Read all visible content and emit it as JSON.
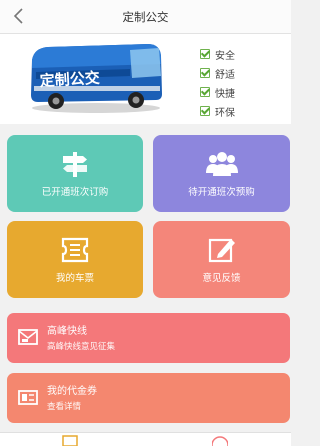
{
  "header": {
    "title": "定制公交"
  },
  "banner": {
    "bus_text": "定制公交",
    "features": [
      "安全",
      "舒适",
      "快捷",
      "环保"
    ]
  },
  "tiles": [
    {
      "label": "已开通班次订购",
      "color": "#5ec9b6",
      "icon": "signpost-icon"
    },
    {
      "label": "待开通班次预购",
      "color": "#8d86dd",
      "icon": "people-icon"
    },
    {
      "label": "我的车票",
      "color": "#e7a92f",
      "icon": "ticket-icon"
    },
    {
      "label": "意见反馈",
      "color": "#f4867a",
      "icon": "edit-icon"
    }
  ],
  "rows": [
    {
      "title": "高峰快线",
      "subtitle": "高峰快线意见征集",
      "color": "#f4787a",
      "icon": "mail-icon"
    },
    {
      "title": "我的代金券",
      "subtitle": "查看详情",
      "color": "#f4876f",
      "icon": "coupon-icon"
    }
  ]
}
